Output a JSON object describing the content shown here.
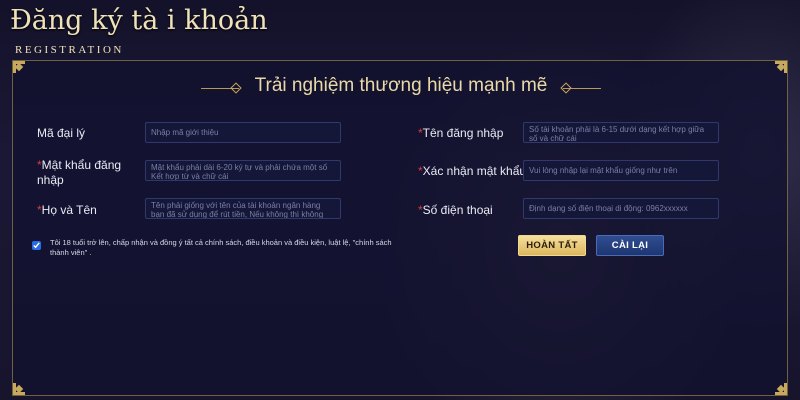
{
  "header": {
    "title": "Đăng ký tà i khoản",
    "subtitle": "REGISTRATION"
  },
  "form": {
    "heading": "Trải nghiệm thương hiệu mạnh mẽ",
    "fields": {
      "agent_code": {
        "label": "Mã đại lý",
        "placeholder": "Nhập mã giới thiệu",
        "value": ""
      },
      "username": {
        "label": "Tên đăng nhập",
        "placeholder": "Số tài khoản phải là 6-15 dưới dạng kết hợp giữa số và chữ cái",
        "value": ""
      },
      "password": {
        "label": "Mật khẩu đăng nhập",
        "placeholder": "Mật khẩu phải dài 6-20 ký tự và phải chứa một số Kết hợp từ và chữ cái",
        "value": ""
      },
      "confirm_password": {
        "label": "Xác nhận mật khẩu",
        "placeholder": "Vui lòng nhập lại mật khẩu giống như trên",
        "value": ""
      },
      "full_name": {
        "label": "Họ và Tên",
        "placeholder": "Tên phải giống với tên của tài khoản ngân hàng bạn đã sử dụng để rút tiền, Nếu không thì không thể rút",
        "value": ""
      },
      "phone": {
        "label": "Số điện thoại",
        "placeholder": "Định dạng số điện thoại di động: 0962xxxxxx",
        "value": ""
      }
    },
    "required_mark": "*",
    "agreement": {
      "checked": true,
      "text": "Tôi 18 tuổi trở lên, chấp nhận và đồng ý tất cả chính sách, điều khoản và điều kiện, luật lệ,   \"chính sách thành viên\" ."
    },
    "buttons": {
      "submit": "HOÀN TẤT",
      "reset": "CÀI LẠI"
    }
  },
  "colors": {
    "background": "#1b1836",
    "gold_accent": "#c9a95c",
    "submit_button": "#e8c873",
    "reset_button": "#263f7e",
    "required_mark": "#e03b3b",
    "input_border": "#31386e"
  }
}
